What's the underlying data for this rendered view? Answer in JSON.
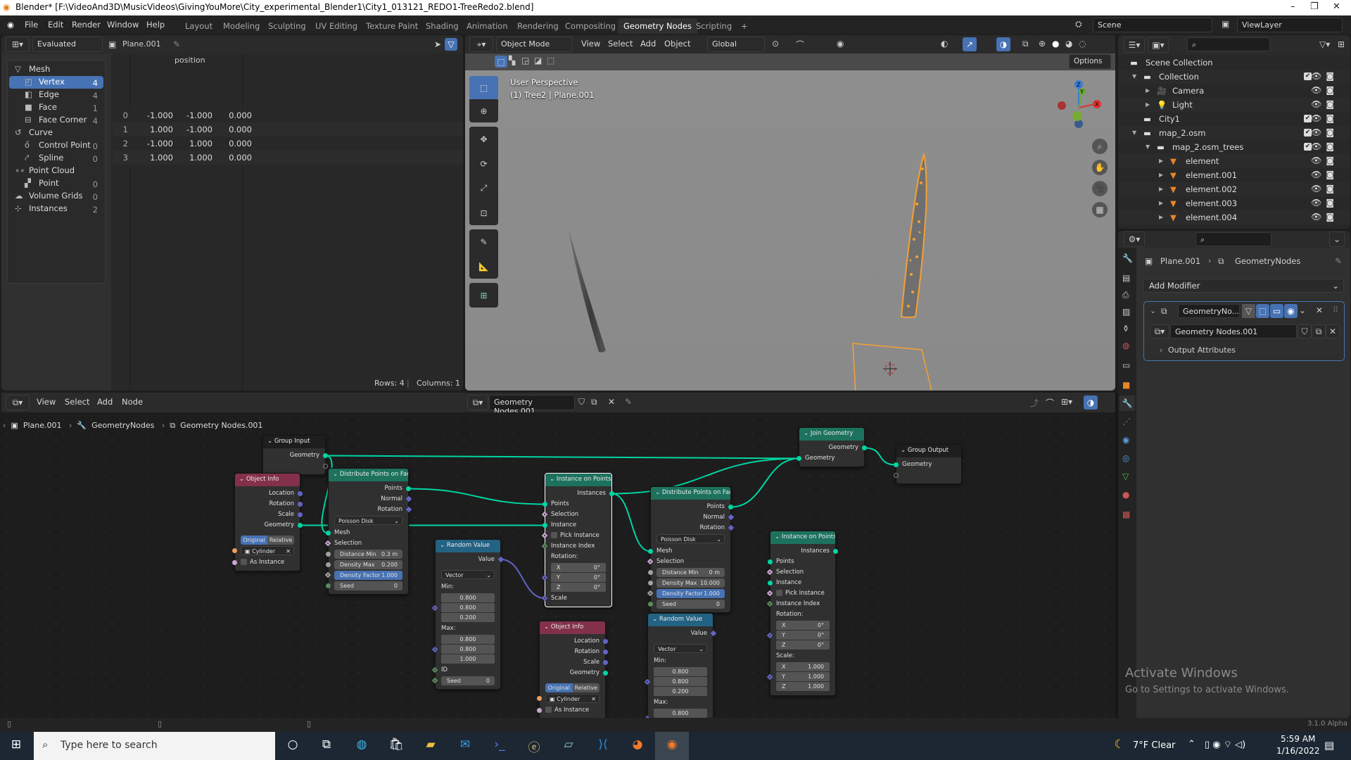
{
  "window": {
    "title": "Blender* [F:\\VideoAnd3D\\MusicVideos\\GivingYouMore\\City_experimental_Blender1\\City1_013121_REDO1-TreeRedo2.blend]",
    "minimize": "–",
    "maximize": "❐",
    "close": "✕"
  },
  "menu": [
    "File",
    "Edit",
    "Render",
    "Window",
    "Help"
  ],
  "workspaces": [
    "Layout",
    "Modeling",
    "Sculpting",
    "UV Editing",
    "Texture Paint",
    "Shading",
    "Animation",
    "Rendering",
    "Compositing",
    "Geometry Nodes",
    "Scripting",
    "+"
  ],
  "active_workspace": "Geometry Nodes",
  "scene": "Scene",
  "view_layer": "ViewLayer",
  "spreadsheet": {
    "mode": "Evaluated",
    "object": "Plane.001",
    "domains": [
      {
        "label": "Mesh",
        "group": true,
        "icon": "mesh-icon"
      },
      {
        "label": "Vertex",
        "count": "4",
        "selected": true,
        "icon": "vertex-icon"
      },
      {
        "label": "Edge",
        "count": "4",
        "icon": "edge-icon"
      },
      {
        "label": "Face",
        "count": "1",
        "icon": "face-icon"
      },
      {
        "label": "Face Corner",
        "count": "4",
        "icon": "face-corner-icon"
      },
      {
        "label": "Curve",
        "group": true,
        "icon": "curve-icon"
      },
      {
        "label": "Control Point",
        "count": "0",
        "icon": "control-point-icon"
      },
      {
        "label": "Spline",
        "count": "0",
        "icon": "spline-icon"
      },
      {
        "label": "Point Cloud",
        "group": true,
        "icon": "point-cloud-icon"
      },
      {
        "label": "Point",
        "count": "0",
        "icon": "point-icon"
      },
      {
        "label": "Volume Grids",
        "count": "0",
        "group": true,
        "icon": "volume-icon"
      },
      {
        "label": "Instances",
        "count": "2",
        "group": true,
        "icon": "instances-icon"
      }
    ],
    "column": "position",
    "rows": [
      {
        "index": "0",
        "values": [
          "-1.000",
          "-1.000",
          "0.000"
        ]
      },
      {
        "index": "1",
        "values": [
          "1.000",
          "-1.000",
          "0.000"
        ]
      },
      {
        "index": "2",
        "values": [
          "-1.000",
          "1.000",
          "0.000"
        ]
      },
      {
        "index": "3",
        "values": [
          "1.000",
          "1.000",
          "0.000"
        ]
      }
    ],
    "footer_rows": "Rows: 4",
    "footer_cols": "Columns: 1"
  },
  "viewport": {
    "mode": "Object Mode",
    "menus": [
      "View",
      "Select",
      "Add",
      "Object"
    ],
    "orientation": "Global",
    "options": "Options",
    "perspective": "User Perspective",
    "info": "(1) Tree2 | Plane.001",
    "gizmo": {
      "x": "X",
      "y": "Y",
      "z": "Z"
    }
  },
  "outliner": {
    "items": [
      {
        "label": "Scene Collection",
        "icon": "scene-collection-icon"
      },
      {
        "label": "Collection",
        "icon": "collection-icon",
        "check": true
      },
      {
        "label": "Camera",
        "icon": "camera-icon"
      },
      {
        "label": "Light",
        "icon": "light-icon"
      },
      {
        "label": "City1",
        "icon": "collection-icon",
        "check": true
      },
      {
        "label": "map_2.osm",
        "icon": "collection-icon",
        "check": true
      },
      {
        "label": "map_2.osm_trees",
        "icon": "collection-icon",
        "check": true
      },
      {
        "label": "element",
        "icon": "mesh-object-icon"
      },
      {
        "label": "element.001",
        "icon": "mesh-object-icon"
      },
      {
        "label": "element.002",
        "icon": "mesh-object-icon"
      },
      {
        "label": "element.003",
        "icon": "mesh-object-icon"
      },
      {
        "label": "element.004",
        "icon": "mesh-object-icon"
      }
    ]
  },
  "properties": {
    "object": "Plane.001",
    "modifier_path": "GeometryNodes",
    "add_modifier": "Add Modifier",
    "modifier_name": "GeometryNo...",
    "node_group": "Geometry Nodes.001",
    "output_attributes": "Output Attributes"
  },
  "watermark": {
    "title": "Activate Windows",
    "subtitle": "Go to Settings to activate Windows."
  },
  "node_editor": {
    "menus": [
      "View",
      "Select",
      "Add",
      "Node"
    ],
    "node_group": "Geometry Nodes.001",
    "breadcrumb": [
      "Plane.001",
      "GeometryNodes",
      "Geometry Nodes.001"
    ],
    "categories": {
      "geometry": "#1d725e",
      "input": "#83314a",
      "utility": "#246283",
      "group": "#1e1e1e"
    },
    "socket_types": {
      "geometry": {
        "color": "#00d6a3",
        "shape": "circle"
      },
      "vector": {
        "color": "#6363c7",
        "shape": "circle"
      },
      "vector_field": {
        "color": "#6363c7",
        "shape": "diamond"
      },
      "vector_in": {
        "color": "#6363c7",
        "shape": "diamond-dot"
      },
      "float": {
        "color": "#a1a1a1",
        "shape": "circle"
      },
      "float_field": {
        "color": "#a1a1a1",
        "shape": "diamond-dot"
      },
      "int": {
        "color": "#598c5c",
        "shape": "circle"
      },
      "int_field": {
        "color": "#598c5c",
        "shape": "diamond-dot"
      },
      "bool_field": {
        "color": "#cca6d6",
        "shape": "diamond-dot"
      },
      "bool": {
        "color": "#cca6d6",
        "shape": "circle"
      },
      "object": {
        "color": "#ed9e5c",
        "shape": "circle"
      },
      "empty": {
        "color": "#808080",
        "shape": "hollow"
      }
    },
    "nodes": [
      {
        "id": "gi",
        "title": "Group Input",
        "category": "group",
        "rows": [
          {
            "t": "out",
            "id": "geometry",
            "text": "Geometry",
            "s": "geometry"
          },
          {
            "t": "out",
            "id": "empty",
            "text": "",
            "s": "empty"
          }
        ]
      },
      {
        "id": "oi1",
        "title": "Object Info",
        "category": "input",
        "rows": [
          {
            "t": "out",
            "text": "Location",
            "s": "vector"
          },
          {
            "t": "out",
            "text": "Rotation",
            "s": "vector"
          },
          {
            "t": "out",
            "text": "Scale",
            "s": "vector"
          },
          {
            "t": "out",
            "id": "geometry",
            "text": "Geometry",
            "s": "geometry"
          },
          {
            "t": "gap"
          },
          {
            "t": "toggle",
            "options": [
              "Original",
              "Relative"
            ],
            "active": 0
          },
          {
            "t": "obj",
            "text": "Cylinder",
            "s": "object"
          },
          {
            "t": "check",
            "text": "As Instance",
            "s": "bool"
          }
        ]
      },
      {
        "id": "dist1",
        "title": "Distribute Points on Faces",
        "category": "geometry",
        "rows": [
          {
            "t": "out",
            "id": "points",
            "text": "Points",
            "s": "geometry"
          },
          {
            "t": "out",
            "text": "Normal",
            "s": "vector_field"
          },
          {
            "t": "out",
            "text": "Rotation",
            "s": "vector_field"
          },
          {
            "t": "select",
            "text": "Poisson Disk"
          },
          {
            "t": "in",
            "id": "mesh",
            "text": "Mesh",
            "s": "geometry"
          },
          {
            "t": "in",
            "text": "Selection",
            "s": "bool_field"
          },
          {
            "t": "field",
            "text": "Distance Min",
            "value": "0.3 m",
            "s": "float"
          },
          {
            "t": "field",
            "text": "Density Max",
            "value": "0.200",
            "s": "float"
          },
          {
            "t": "field",
            "text": "Density Factor",
            "value": "1.000",
            "s": "float_field",
            "active": true
          },
          {
            "t": "field",
            "text": "Seed",
            "value": "0",
            "s": "int"
          }
        ]
      },
      {
        "id": "rv1",
        "title": "Random Value",
        "category": "utility",
        "rows": [
          {
            "t": "out",
            "id": "value",
            "text": "Value",
            "s": "vector_field"
          },
          {
            "t": "gap"
          },
          {
            "t": "select",
            "text": "Vector"
          },
          {
            "t": "label",
            "text": "Min:"
          },
          {
            "t": "vec",
            "values": [
              "0.800",
              "0.800",
              "0.200"
            ],
            "s": "vector_in"
          },
          {
            "t": "label",
            "text": "Max:"
          },
          {
            "t": "vec",
            "values": [
              "0.800",
              "0.800",
              "1.000"
            ],
            "s": "vector_in"
          },
          {
            "t": "in",
            "text": "ID",
            "s": "int_field"
          },
          {
            "t": "field",
            "text": "Seed",
            "value": "0",
            "s": "int_field"
          }
        ]
      },
      {
        "id": "iop1",
        "title": "Instance on Points",
        "category": "geometry",
        "selected": true,
        "rows": [
          {
            "t": "out",
            "id": "instances",
            "text": "Instances",
            "s": "geometry"
          },
          {
            "t": "in",
            "id": "points",
            "text": "Points",
            "s": "geometry"
          },
          {
            "t": "in",
            "text": "Selection",
            "s": "bool_field"
          },
          {
            "t": "in",
            "id": "instance",
            "text": "Instance",
            "s": "geometry"
          },
          {
            "t": "check",
            "text": "Pick Instance",
            "s": "bool_field"
          },
          {
            "t": "in",
            "text": "Instance Index",
            "s": "int_field"
          },
          {
            "t": "label",
            "text": "Rotation:"
          },
          {
            "t": "vec",
            "axes": [
              "X",
              "Y",
              "Z"
            ],
            "values": [
              "0°",
              "0°",
              "0°"
            ],
            "s": "vector_in"
          },
          {
            "t": "in",
            "id": "scale",
            "text": "Scale",
            "s": "vector_in"
          }
        ]
      },
      {
        "id": "oi2",
        "title": "Object Info",
        "category": "input",
        "rows": [
          {
            "t": "out",
            "text": "Location",
            "s": "vector"
          },
          {
            "t": "out",
            "text": "Rotation",
            "s": "vector"
          },
          {
            "t": "out",
            "text": "Scale",
            "s": "vector"
          },
          {
            "t": "out",
            "text": "Geometry",
            "s": "geometry"
          },
          {
            "t": "gap"
          },
          {
            "t": "toggle",
            "options": [
              "Original",
              "Relative"
            ],
            "active": 0
          },
          {
            "t": "obj",
            "text": "Cylinder",
            "s": "object"
          },
          {
            "t": "check",
            "text": "As Instance",
            "s": "bool"
          }
        ]
      },
      {
        "id": "dist2",
        "title": "Distribute Points on Faces",
        "category": "geometry",
        "rows": [
          {
            "t": "out",
            "id": "points",
            "text": "Points",
            "s": "geometry"
          },
          {
            "t": "out",
            "text": "Normal",
            "s": "vector_field"
          },
          {
            "t": "out",
            "text": "Rotation",
            "s": "vector_field"
          },
          {
            "t": "select",
            "text": "Poisson Disk"
          },
          {
            "t": "in",
            "id": "mesh",
            "text": "Mesh",
            "s": "geometry"
          },
          {
            "t": "in",
            "text": "Selection",
            "s": "bool_field"
          },
          {
            "t": "field",
            "text": "Distance Min",
            "value": "0 m",
            "s": "float"
          },
          {
            "t": "field",
            "text": "Density Max",
            "value": "10.000",
            "s": "float"
          },
          {
            "t": "field",
            "text": "Density Factor",
            "value": "1.000",
            "s": "float_field",
            "active": true
          },
          {
            "t": "field",
            "text": "Seed",
            "value": "0",
            "s": "int"
          }
        ]
      },
      {
        "id": "rv2",
        "title": "Random Value",
        "category": "utility",
        "rows": [
          {
            "t": "out",
            "text": "Value",
            "s": "vector_field"
          },
          {
            "t": "gap"
          },
          {
            "t": "select",
            "text": "Vector"
          },
          {
            "t": "label",
            "text": "Min:"
          },
          {
            "t": "vec",
            "values": [
              "0.800",
              "0.800",
              "0.200"
            ],
            "s": "vector_in"
          },
          {
            "t": "label",
            "text": "Max:"
          },
          {
            "t": "vec",
            "values": [
              "0.800",
              "0.800"
            ],
            "s": "vector_in"
          }
        ]
      },
      {
        "id": "iop2",
        "title": "Instance on Points",
        "category": "geometry",
        "rows": [
          {
            "t": "out",
            "text": "Instances",
            "s": "geometry"
          },
          {
            "t": "in",
            "text": "Points",
            "s": "geometry"
          },
          {
            "t": "in",
            "text": "Selection",
            "s": "bool_field"
          },
          {
            "t": "in",
            "text": "Instance",
            "s": "geometry"
          },
          {
            "t": "check",
            "text": "Pick Instance",
            "s": "bool_field"
          },
          {
            "t": "in",
            "text": "Instance Index",
            "s": "int_field"
          },
          {
            "t": "label",
            "text": "Rotation:"
          },
          {
            "t": "vec",
            "axes": [
              "X",
              "Y",
              "Z"
            ],
            "values": [
              "0°",
              "0°",
              "0°"
            ],
            "s": "vector_in"
          },
          {
            "t": "label",
            "text": "Scale:"
          },
          {
            "t": "vec",
            "axes": [
              "X",
              "Y",
              "Z"
            ],
            "values": [
              "1.000",
              "1.000",
              "1.000"
            ],
            "s": "vector_in"
          }
        ]
      },
      {
        "id": "join",
        "title": "Join Geometry",
        "category": "geometry",
        "rows": [
          {
            "t": "out",
            "id": "geometry",
            "text": "Geometry",
            "s": "geometry"
          },
          {
            "t": "in",
            "id": "geometry_in",
            "text": "Geometry",
            "s": "geometry"
          }
        ]
      },
      {
        "id": "gout",
        "title": "Group Output",
        "category": "group",
        "rows": [
          {
            "t": "in",
            "id": "geometry",
            "text": "Geometry",
            "s": "geometry"
          },
          {
            "t": "in",
            "text": "",
            "s": "empty"
          }
        ]
      }
    ],
    "links": [
      {
        "from": "gi.geometry",
        "to": "join.geometry_in",
        "color": "#00d6a3"
      },
      {
        "from": "gi.geometry",
        "to": "dist1.mesh",
        "color": "#00d6a3"
      },
      {
        "from": "oi1.geometry",
        "to": "iop1.instance",
        "color": "#00d6a3"
      },
      {
        "from": "dist1.points",
        "to": "iop1.points",
        "color": "#00d6a3"
      },
      {
        "from": "rv1.value",
        "to": "iop1.scale",
        "color": "#6363c7"
      },
      {
        "from": "iop1.instances",
        "to": "join.geometry_in",
        "color": "#00d6a3"
      },
      {
        "from": "iop1.instances",
        "to": "dist2.mesh",
        "color": "#00d6a3"
      },
      {
        "from": "dist2.points",
        "to": "join.geometry_in",
        "color": "#00d6a3"
      },
      {
        "from": "join.geometry",
        "to": "gout.geometry",
        "color": "#00d6a3"
      }
    ]
  },
  "status_bar": {
    "version": "3.1.0 Alpha"
  },
  "taskbar": {
    "search_placeholder": "Type here to search",
    "weather": "7°F  Clear",
    "time": "5:59 AM",
    "date": "1/16/2022"
  }
}
